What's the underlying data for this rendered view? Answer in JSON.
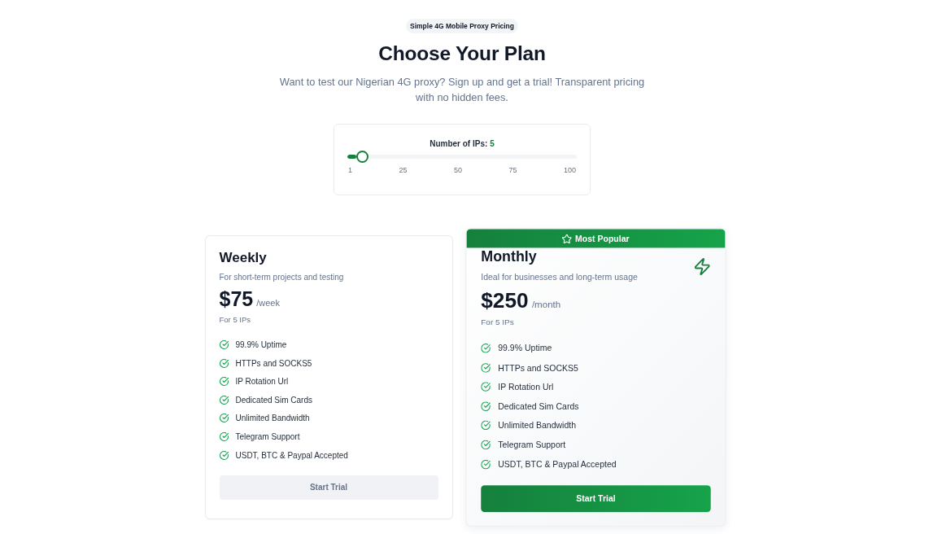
{
  "header": {
    "badge": "Simple 4G Mobile Proxy Pricing",
    "title": "Choose Your Plan",
    "subtitle": "Want to test our Nigerian 4G proxy? Sign up and get a trial! Transparent pricing with no hidden fees."
  },
  "ip_slider": {
    "label": "Number of IPs:",
    "value": "5",
    "level": 0.04,
    "ticks": [
      "1",
      "25",
      "50",
      "75",
      "100"
    ]
  },
  "plans": [
    {
      "name": "Weekly",
      "featured": false,
      "description": "For short-term projects and testing",
      "price": "$75",
      "period": "/week",
      "note": "For 5 IPs",
      "features": [
        "99.9% Uptime",
        "HTTPs and SOCKS5",
        "IP Rotation Url",
        "Dedicated Sim Cards",
        "Unlimited Bandwidth",
        "Telegram Support",
        "USDT, BTC & Paypal Accepted"
      ],
      "button": "Start Trial"
    },
    {
      "name": "Monthly",
      "featured": true,
      "badge": "Most Popular",
      "description": "Ideal for businesses and long-term usage",
      "price": "$250",
      "period": "/month",
      "note": "For 5 IPs",
      "features": [
        "99.9% Uptime",
        "HTTPs and SOCKS5",
        "IP Rotation Url",
        "Dedicated Sim Cards",
        "Unlimited Bandwidth",
        "Telegram Support",
        "USDT, BTC & Paypal Accepted"
      ],
      "button": "Start Trial"
    }
  ]
}
